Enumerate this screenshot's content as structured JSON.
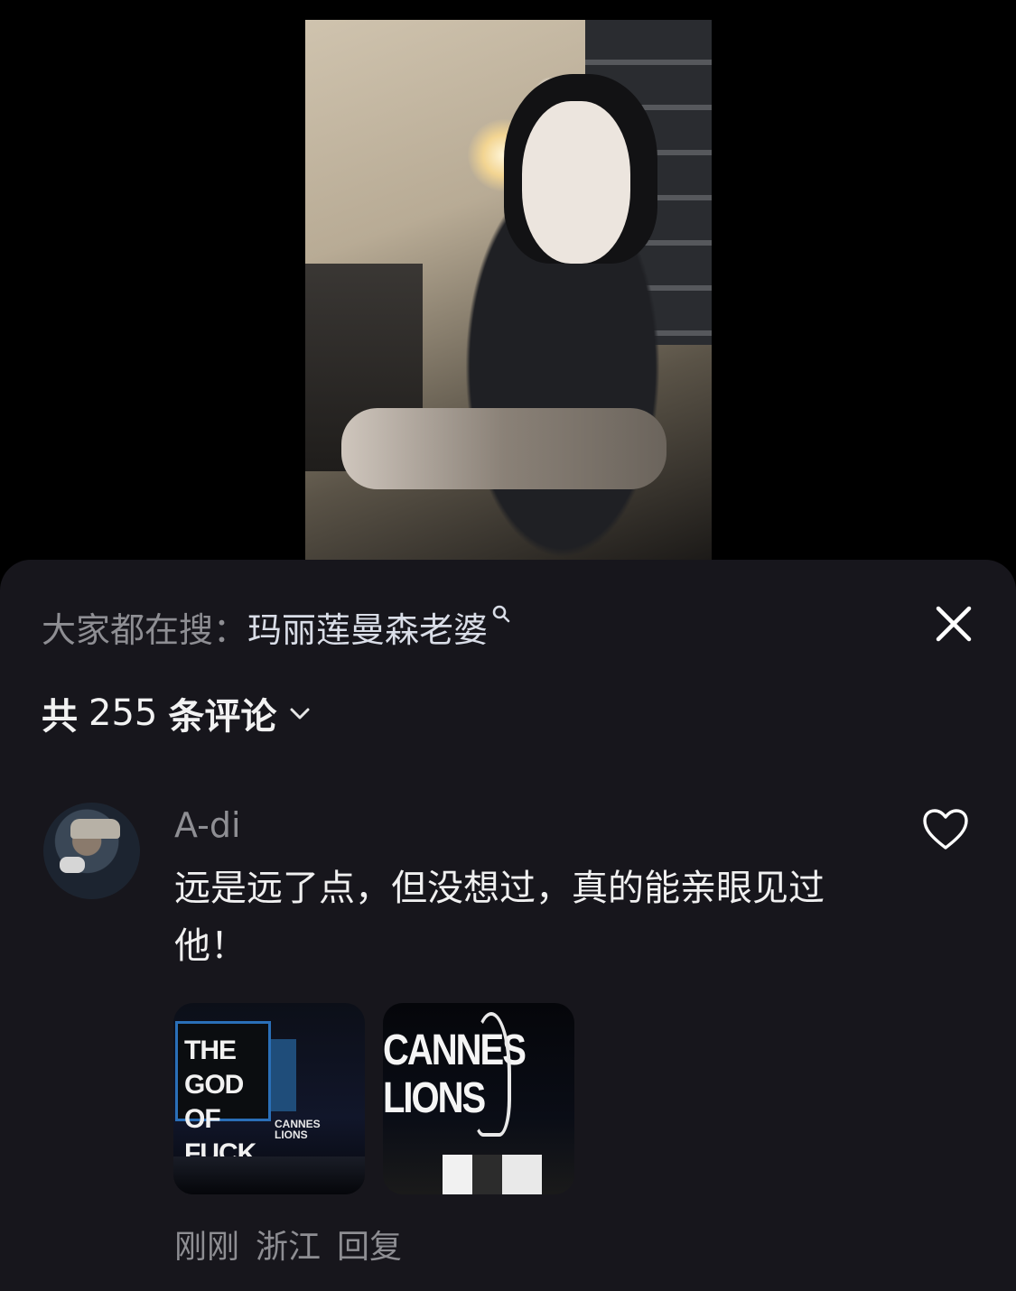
{
  "search_suggestion": {
    "prefix": "大家都在搜：",
    "term": "玛丽莲曼森老婆"
  },
  "comments_header": {
    "prefix": "共",
    "count": "255",
    "suffix": "条评论"
  },
  "comment": {
    "username": "A-di",
    "text": "远是远了点，但没想过，真的能亲眼见过他！",
    "images": [
      {
        "caption": "THE GOD OF FUCK"
      },
      {
        "caption": "CANNES LIONS"
      }
    ],
    "time": "刚刚",
    "location": "浙江",
    "reply_label": "回复"
  },
  "icons": {
    "close": "close-icon",
    "expand": "chevron-down-icon",
    "like": "heart-icon",
    "search": "search-icon"
  }
}
